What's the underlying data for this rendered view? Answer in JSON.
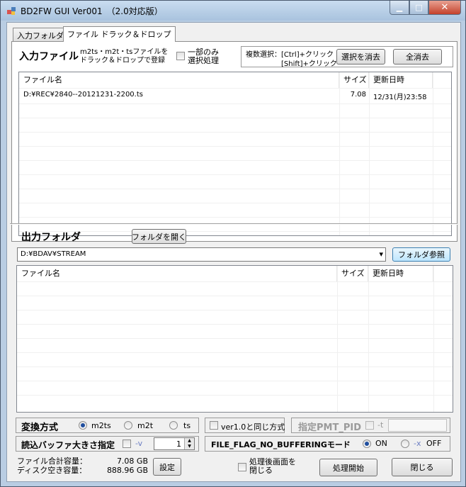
{
  "window": {
    "title": "BD2FW GUI Ver001　（2.0対応版）",
    "min_glyph": "▁",
    "max_glyph": "□",
    "close_glyph": "✕"
  },
  "tabs": [
    {
      "label": "入力フォルダ",
      "active": false
    },
    {
      "label": "ファイル ドラック＆ドロップ",
      "active": true
    }
  ],
  "input": {
    "heading": "入力ファイル",
    "hint_line1": "m2ts・m2t・tsファイルを",
    "hint_line2": "ドラック＆ドロップで登録",
    "partial_line1": "一部のみ",
    "partial_line2": "選択処理",
    "multi_line1": "複数選択：[Ctrl]+クリック",
    "multi_line2": "[Shift]+クリック",
    "clear_selection": "選択を消去",
    "clear_all": "全消去",
    "columns": [
      "ファイル名",
      "サイズ",
      "更新日時"
    ],
    "rows": [
      {
        "name": "D:¥REC¥2840--20121231-2200.ts",
        "size": "7.08",
        "date": "12/31(月)23:58"
      }
    ]
  },
  "output": {
    "heading": "出力フォルダ",
    "open_folder": "フォルダを開く",
    "path": "D:¥BDAV¥STREAM",
    "browse": "フォルダ参照",
    "columns": [
      "ファイル名",
      "サイズ",
      "更新日時"
    ]
  },
  "conversion": {
    "label": "変換方式",
    "options": [
      "m2ts",
      "m2t",
      "ts"
    ],
    "selected": "m2ts",
    "v10_label": "ver1.0と同じ方式",
    "pmt_label": "指定PMT_PID",
    "pmt_flag": "-t",
    "pmt_value": ""
  },
  "buffer": {
    "label": "読込バッファ大きさ指定",
    "flag": "-v",
    "value": "1",
    "spin_up": "▲",
    "spin_down": "▼"
  },
  "nobuffer": {
    "label": "FILE_FLAG_NO_BUFFERINGモード",
    "on": "ON",
    "off_flag": "-x",
    "off": "OFF",
    "selected": "ON"
  },
  "footer": {
    "total_label": "ファイル合計容量：",
    "total_value": "7.08 GB",
    "free_label": "ディスク空き容量：",
    "free_value": "888.96 GB",
    "settings": "設定",
    "close_after_line1": "処理後画面を",
    "close_after_line2": "閉じる",
    "start": "処理開始",
    "close": "閉じる"
  },
  "dropdown_arrow": "▾"
}
